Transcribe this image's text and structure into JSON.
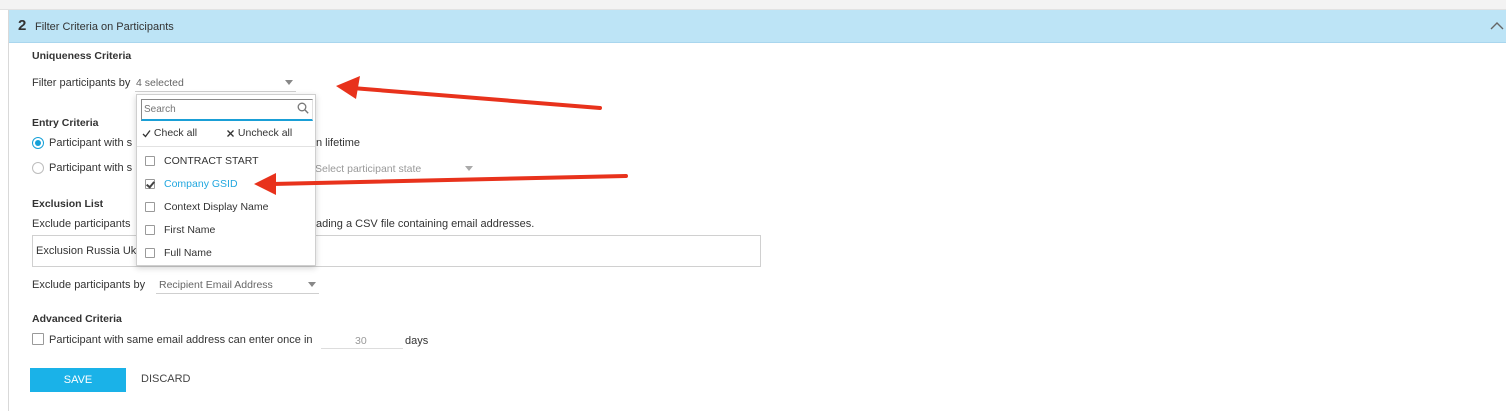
{
  "panel": {
    "step_number": "2",
    "title": "Filter Criteria on Participants"
  },
  "uniqueness": {
    "heading": "Uniqueness Criteria",
    "filter_label": "Filter participants by",
    "filter_value": "4 selected"
  },
  "dropdown": {
    "search_placeholder": "Search",
    "check_all": "Check all",
    "uncheck_all": "Uncheck all",
    "items": [
      {
        "label": "CONTRACT START",
        "checked": false
      },
      {
        "label": "Company GSID",
        "checked": true
      },
      {
        "label": "Context Display Name",
        "checked": false
      },
      {
        "label": "First Name",
        "checked": false
      },
      {
        "label": "Full Name",
        "checked": false
      }
    ]
  },
  "entry": {
    "heading": "Entry Criteria",
    "option1_prefix": "Participant with s",
    "option1_suffix": "n lifetime",
    "option2_prefix": "Participant with s",
    "state_placeholder": "Select participant state"
  },
  "exclusion": {
    "heading": "Exclusion List",
    "desc_prefix": "Exclude participants",
    "desc_suffix": "ading a CSV file containing email addresses.",
    "list_value": "Exclusion Russia Uk",
    "exclude_by_label": "Exclude participants by",
    "exclude_by_value": "Recipient Email Address"
  },
  "advanced": {
    "heading": "Advanced Criteria",
    "same_email_label": "Participant with same email address can enter once in",
    "days_value": "30",
    "days_unit": "days"
  },
  "actions": {
    "save": "SAVE",
    "discard": "DISCARD"
  },
  "colors": {
    "header_bg": "#bde4f6",
    "accent": "#1ab2e8",
    "annotation_arrow": "#e8321c"
  }
}
